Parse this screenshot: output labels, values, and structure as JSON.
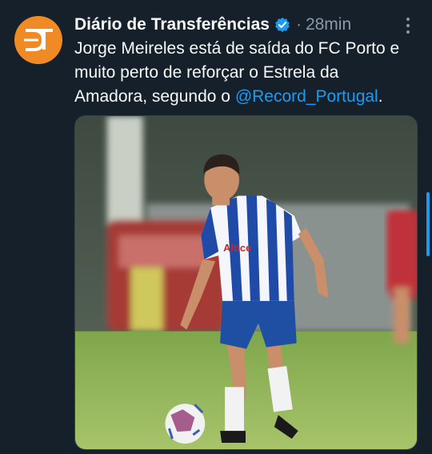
{
  "tweet": {
    "author_name": "Diário de Transferências",
    "separator": "·",
    "time": "28min",
    "text_before_mention": "Jorge Meireles está de saída do FC Porto e muito perto de reforçar o Estrela da Amadora, segundo o ",
    "mention": "@Record_Portugal",
    "text_after_mention": ".",
    "avatar_letters": "DT",
    "shirt_sponsor": "Altice"
  },
  "icons": {
    "verified": "verified-badge-icon",
    "more": "more-options-icon"
  },
  "colors": {
    "background": "#15202b",
    "accent": "#1d9bf0",
    "avatar": "#f08a24",
    "secondary_text": "#8b98a5"
  }
}
